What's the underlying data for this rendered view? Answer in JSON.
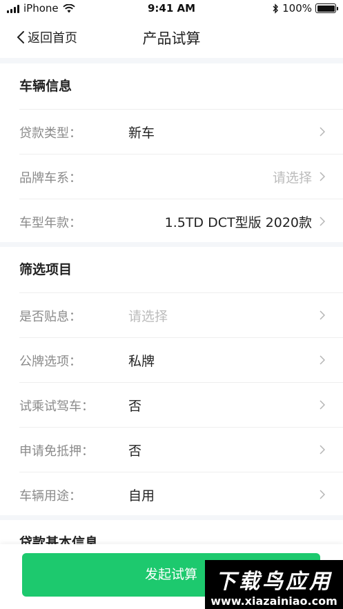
{
  "status_bar": {
    "carrier": "iPhone",
    "time": "9:41 AM",
    "battery": "100%",
    "battery_level": 1.0
  },
  "nav": {
    "back_label": "返回首页",
    "title": "产品试算"
  },
  "vehicle_info": {
    "title": "车辆信息",
    "rows": [
      {
        "label": "贷款类型：",
        "value": "新车"
      },
      {
        "label": "品牌车系：",
        "value": "请选择"
      },
      {
        "label": "车型年款：",
        "value": "1.5TD DCT型版 2020款"
      }
    ]
  },
  "filters": {
    "title": "筛选项目",
    "rows": [
      {
        "label": "是否贴息：",
        "value": "请选择"
      },
      {
        "label": "公牌选项：",
        "value": "私牌"
      },
      {
        "label": "试乘试驾车：",
        "value": "否"
      },
      {
        "label": "申请免抵押：",
        "value": "否"
      },
      {
        "label": "车辆用途：",
        "value": "自用"
      }
    ]
  },
  "loan_info": {
    "title": "贷款基本信息"
  },
  "footer": {
    "submit_label": "发起试算"
  },
  "watermark": {
    "top": "下载鸟应用",
    "bottom": "www.xiazainiao.com"
  },
  "colors": {
    "accent": "#1dc96e",
    "placeholder": "#bcbcbc",
    "label": "#8a8a8a"
  }
}
